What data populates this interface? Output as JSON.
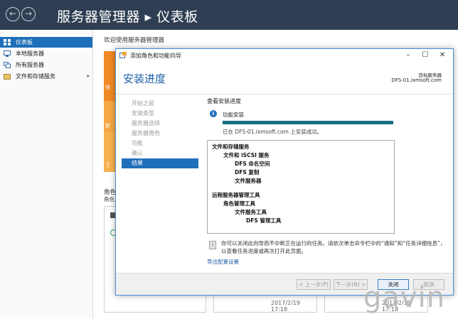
{
  "app": {
    "title": "服务器管理器 ▸ 仪表板",
    "back_icon": "back-arrow-icon",
    "forward_icon": "forward-arrow-icon"
  },
  "sidebar": {
    "items": [
      {
        "label": "仪表板",
        "icon": "dashboard-icon",
        "active": true
      },
      {
        "label": "本地服务器",
        "icon": "server-icon",
        "active": false
      },
      {
        "label": "所有服务器",
        "icon": "servers-icon",
        "active": false
      },
      {
        "label": "文件和存储服务",
        "icon": "storage-icon",
        "active": false
      }
    ],
    "expand_glyph": "▸"
  },
  "dashboard": {
    "welcome": "欢迎使用服务器管理器",
    "tile_texts": [
      "快",
      "新",
      "了"
    ],
    "roles_heading": "角色",
    "roles_sub": "角色",
    "card_time_1": "2017/2/19 17:18",
    "card_time_2": "2017/2/19 17:18",
    "tile_color": "#f0a030"
  },
  "dialog": {
    "title": "添加角色和功能向导",
    "page_title": "安装进度",
    "dest_label": "目标服务器",
    "dest_server": "DFS-01.ixmsoft.com",
    "steps": [
      "开始之前",
      "安装类型",
      "服务器选择",
      "服务器角色",
      "功能",
      "确认",
      "结果"
    ],
    "active_step": 6,
    "content_heading": "查看安装进度",
    "info_label": "功能安装",
    "progress": 1.0,
    "success_message": "已在 DFS-01.ixmsoft.com 上安装成功。",
    "results_tree": [
      "文件和存储服务",
      "文件和 iSCSI 服务",
      "DFS 命名空间",
      "DFS 复制",
      "文件服务器",
      "",
      "远程服务器管理工具",
      "角色管理工具",
      "文件服务工具",
      "DFS 管理工具"
    ],
    "note": "你可以关闭此向导而不中断正在运行的任务。请依次单击命令栏中的“通知”和“任务详细信息”，以查看任务进度或再次打开此页面。",
    "export_link": "导出配置设置",
    "buttons": {
      "previous": "< 上一步(P)",
      "next": "下一步(N) >",
      "close": "关闭",
      "cancel": "取消"
    },
    "accent_color": "#1e6fb9"
  },
  "watermark": "gavin"
}
